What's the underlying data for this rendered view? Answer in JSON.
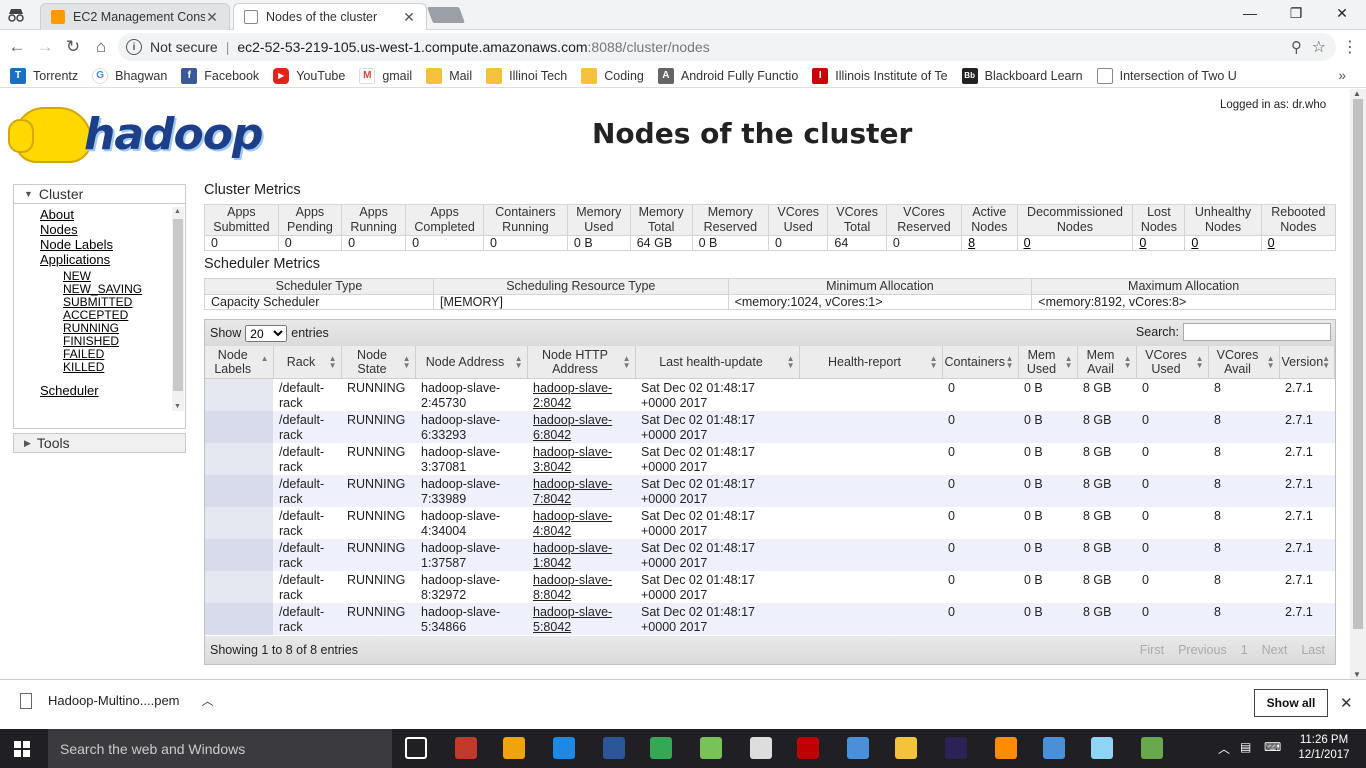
{
  "browser": {
    "tabs": [
      {
        "title": "EC2 Management Conso",
        "active": false
      },
      {
        "title": "Nodes of the cluster",
        "active": true
      }
    ],
    "security_label": "Not secure",
    "url_host": "ec2-52-53-219-105.us-west-1.compute.amazonaws.com",
    "url_path": ":8088/cluster/nodes",
    "bookmarks": [
      {
        "label": "Torrentz",
        "icon": "torrentz-icon",
        "color": "#1a6fbf"
      },
      {
        "label": "Bhagwan",
        "icon": "google-icon",
        "color": "#4285f4"
      },
      {
        "label": "Facebook",
        "icon": "facebook-icon",
        "color": "#3b5998"
      },
      {
        "label": "YouTube",
        "icon": "youtube-icon",
        "color": "#e62117"
      },
      {
        "label": "gmail",
        "icon": "gmail-icon",
        "color": "#d44638"
      },
      {
        "label": "Mail",
        "icon": "folder-icon",
        "color": "#f5c33b"
      },
      {
        "label": "Illinoi Tech",
        "icon": "folder-icon",
        "color": "#f5c33b"
      },
      {
        "label": "Coding",
        "icon": "folder-icon",
        "color": "#f5c33b"
      },
      {
        "label": "Android Fully Functio",
        "icon": "android-icon",
        "color": "#666666"
      },
      {
        "label": "Illinois Institute of Te",
        "icon": "iit-icon",
        "color": "#cc0000"
      },
      {
        "label": "Blackboard Learn",
        "icon": "blackboard-icon",
        "color": "#222222"
      },
      {
        "label": "Intersection of Two U",
        "icon": "page-icon",
        "color": "#888888"
      }
    ]
  },
  "header": {
    "logo_text": "hadoop",
    "title": "Nodes of the cluster",
    "logged_in": "Logged in as: dr.who"
  },
  "nav": {
    "cluster_label": "Cluster",
    "cluster_items": [
      "About",
      "Nodes",
      "Node Labels",
      "Applications"
    ],
    "app_states": [
      "NEW",
      "NEW_SAVING",
      "SUBMITTED",
      "ACCEPTED",
      "RUNNING",
      "FINISHED",
      "FAILED",
      "KILLED"
    ],
    "scheduler_label": "Scheduler",
    "tools_label": "Tools"
  },
  "cluster_metrics": {
    "title": "Cluster Metrics",
    "headers": [
      "Apps Submitted",
      "Apps Pending",
      "Apps Running",
      "Apps Completed",
      "Containers Running",
      "Memory Used",
      "Memory Total",
      "Memory Reserved",
      "VCores Used",
      "VCores Total",
      "VCores Reserved",
      "Active Nodes",
      "Decommissioned Nodes",
      "Lost Nodes",
      "Unhealthy Nodes",
      "Rebooted Nodes"
    ],
    "values": [
      "0",
      "0",
      "0",
      "0",
      "0",
      "0 B",
      "64 GB",
      "0 B",
      "0",
      "64",
      "0",
      "8",
      "0",
      "0",
      "0",
      "0"
    ],
    "linked": [
      false,
      false,
      false,
      false,
      false,
      false,
      false,
      false,
      false,
      false,
      false,
      true,
      true,
      true,
      true,
      true
    ]
  },
  "scheduler_metrics": {
    "title": "Scheduler Metrics",
    "headers": [
      "Scheduler Type",
      "Scheduling Resource Type",
      "Minimum Allocation",
      "Maximum Allocation"
    ],
    "values": [
      "Capacity Scheduler",
      "[MEMORY]",
      "<memory:1024, vCores:1>",
      "<memory:8192, vCores:8>"
    ]
  },
  "table": {
    "show_label": "Show",
    "page_size": "20",
    "entries_label": "entries",
    "search_label": "Search:",
    "search_value": "",
    "columns": [
      "Node Labels",
      "Rack",
      "Node State",
      "Node Address",
      "Node HTTP Address",
      "Last health-update",
      "Health-report",
      "Containers",
      "Mem Used",
      "Mem Avail",
      "VCores Used",
      "VCores Avail",
      "Version"
    ],
    "sorted_column": "Node Labels",
    "rows": [
      [
        "",
        "/default-rack",
        "RUNNING",
        "hadoop-slave-2:45730",
        "hadoop-slave-2:8042",
        "Sat Dec 02 01:48:17 +0000 2017",
        "",
        "0",
        "0 B",
        "8 GB",
        "0",
        "8",
        "2.7.1"
      ],
      [
        "",
        "/default-rack",
        "RUNNING",
        "hadoop-slave-6:33293",
        "hadoop-slave-6:8042",
        "Sat Dec 02 01:48:17 +0000 2017",
        "",
        "0",
        "0 B",
        "8 GB",
        "0",
        "8",
        "2.7.1"
      ],
      [
        "",
        "/default-rack",
        "RUNNING",
        "hadoop-slave-3:37081",
        "hadoop-slave-3:8042",
        "Sat Dec 02 01:48:17 +0000 2017",
        "",
        "0",
        "0 B",
        "8 GB",
        "0",
        "8",
        "2.7.1"
      ],
      [
        "",
        "/default-rack",
        "RUNNING",
        "hadoop-slave-7:33989",
        "hadoop-slave-7:8042",
        "Sat Dec 02 01:48:17 +0000 2017",
        "",
        "0",
        "0 B",
        "8 GB",
        "0",
        "8",
        "2.7.1"
      ],
      [
        "",
        "/default-rack",
        "RUNNING",
        "hadoop-slave-4:34004",
        "hadoop-slave-4:8042",
        "Sat Dec 02 01:48:17 +0000 2017",
        "",
        "0",
        "0 B",
        "8 GB",
        "0",
        "8",
        "2.7.1"
      ],
      [
        "",
        "/default-rack",
        "RUNNING",
        "hadoop-slave-1:37587",
        "hadoop-slave-1:8042",
        "Sat Dec 02 01:48:17 +0000 2017",
        "",
        "0",
        "0 B",
        "8 GB",
        "0",
        "8",
        "2.7.1"
      ],
      [
        "",
        "/default-rack",
        "RUNNING",
        "hadoop-slave-8:32972",
        "hadoop-slave-8:8042",
        "Sat Dec 02 01:48:17 +0000 2017",
        "",
        "0",
        "0 B",
        "8 GB",
        "0",
        "8",
        "2.7.1"
      ],
      [
        "",
        "/default-rack",
        "RUNNING",
        "hadoop-slave-5:34866",
        "hadoop-slave-5:8042",
        "Sat Dec 02 01:48:17 +0000 2017",
        "",
        "0",
        "0 B",
        "8 GB",
        "0",
        "8",
        "2.7.1"
      ]
    ],
    "info": "Showing 1 to 8 of 8 entries",
    "pager": [
      "First",
      "Previous",
      "1",
      "Next",
      "Last"
    ]
  },
  "downloads": {
    "file": "Hadoop-Multino....pem",
    "show_all": "Show all"
  },
  "taskbar": {
    "search_placeholder": "Search the web and Windows",
    "time": "11:26 PM",
    "date": "12/1/2017",
    "apps": [
      {
        "name": "task-view-icon",
        "color": "#ffffff"
      },
      {
        "name": "app-icon",
        "color": "#c0392b"
      },
      {
        "name": "store-icon",
        "color": "#f0a30a"
      },
      {
        "name": "edge-icon",
        "color": "#1e88e5"
      },
      {
        "name": "word-icon",
        "color": "#2b579a"
      },
      {
        "name": "chrome-icon",
        "color": "#34a853"
      },
      {
        "name": "android-studio-icon",
        "color": "#78c257"
      },
      {
        "name": "paint-icon",
        "color": "#dddddd"
      },
      {
        "name": "filezilla-icon",
        "color": "#bf0000"
      },
      {
        "name": "network-icon",
        "color": "#4a90d9"
      },
      {
        "name": "file-explorer-icon",
        "color": "#f5c33b"
      },
      {
        "name": "eclipse-icon",
        "color": "#2c2255"
      },
      {
        "name": "pdf-icon",
        "color": "#ff8c00"
      },
      {
        "name": "network-icon-2",
        "color": "#4a90d9"
      },
      {
        "name": "putty-icon",
        "color": "#8fd3f5"
      },
      {
        "name": "notepad-icon",
        "color": "#6aa84f"
      }
    ]
  }
}
